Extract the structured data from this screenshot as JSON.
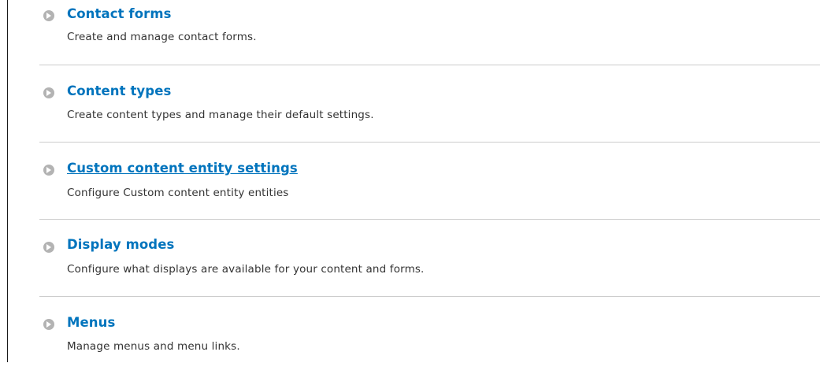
{
  "admin_list": {
    "items": [
      {
        "title": "Contact forms",
        "description": "Create and manage contact forms.",
        "hovered": false
      },
      {
        "title": "Content types",
        "description": "Create content types and manage their default settings.",
        "hovered": false
      },
      {
        "title": "Custom content entity settings",
        "description": "Configure Custom content entity entities",
        "hovered": true
      },
      {
        "title": "Display modes",
        "description": "Configure what displays are available for your content and forms.",
        "hovered": false
      },
      {
        "title": "Menus",
        "description": "Manage menus and menu links.",
        "hovered": false
      }
    ]
  },
  "icons": {
    "bullet": "chevron-right-circle-icon"
  },
  "colors": {
    "link": "#0074bd",
    "description": "#333333",
    "bullet": "#b3b3b3",
    "divider": "#cccccc"
  }
}
